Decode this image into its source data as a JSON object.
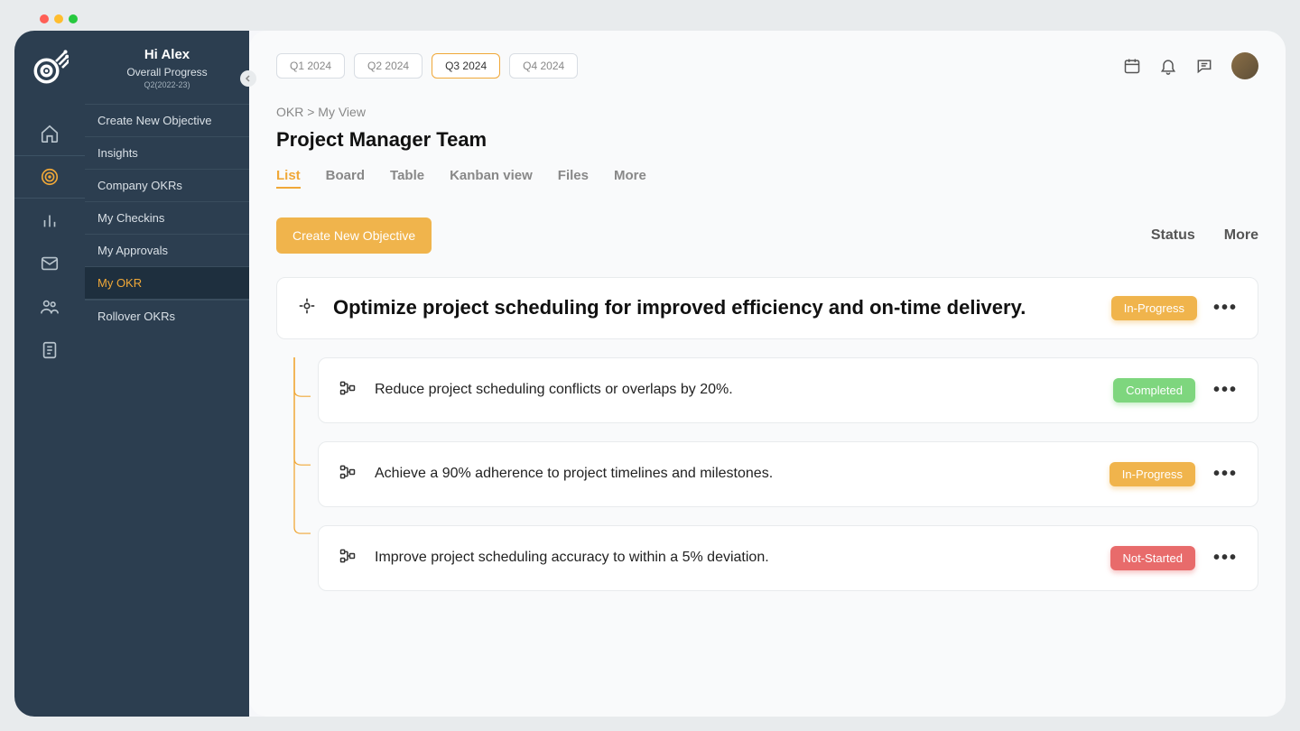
{
  "header": {
    "greeting": "Hi Alex",
    "progress_label": "Overall Progress",
    "progress_sub": "Q2(2022-23)"
  },
  "menu": {
    "items": [
      {
        "label": "Create New Objective"
      },
      {
        "label": "Insights"
      },
      {
        "label": "Company OKRs"
      },
      {
        "label": "My  Checkins"
      },
      {
        "label": "My Approvals"
      },
      {
        "label": "My OKR"
      },
      {
        "label": "Rollover OKRs"
      }
    ],
    "active_index": 5
  },
  "quarters": {
    "tabs": [
      "Q1 2024",
      "Q2 2024",
      "Q3 2024",
      "Q4 2024"
    ],
    "active_index": 2
  },
  "breadcrumb": "OKR > My View",
  "page_title": "Project Manager Team",
  "views": {
    "tabs": [
      "List",
      "Board",
      "Table",
      "Kanban view",
      "Files",
      "More"
    ],
    "active_index": 0
  },
  "toolbar": {
    "create_label": "Create New Objective",
    "status_label": "Status",
    "more_label": "More"
  },
  "objective": {
    "title": "Optimize project scheduling for improved efficiency and on-time delivery.",
    "status": "In-Progress",
    "status_class": "status-inprogress"
  },
  "key_results": [
    {
      "title": "Reduce project scheduling conflicts or overlaps by 20%.",
      "status": "Completed",
      "status_class": "status-completed"
    },
    {
      "title": "Achieve a 90% adherence to project timelines and milestones.",
      "status": "In-Progress",
      "status_class": "status-inprogress"
    },
    {
      "title": "Improve project scheduling accuracy to within a 5% deviation.",
      "status": "Not-Started",
      "status_class": "status-notstarted"
    }
  ]
}
